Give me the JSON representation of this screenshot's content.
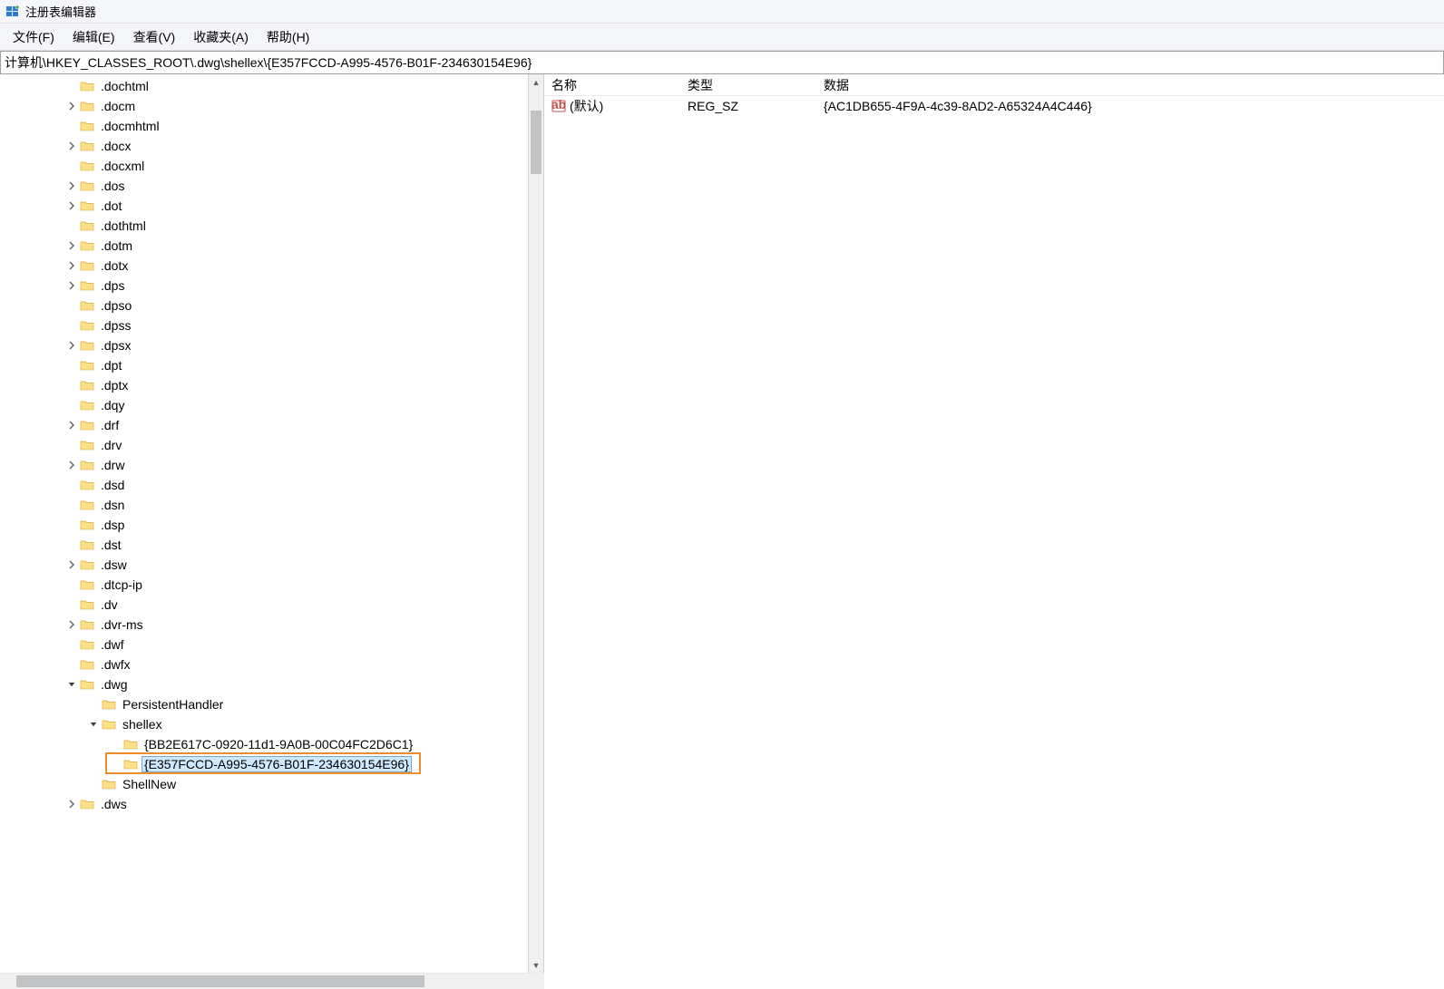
{
  "window": {
    "title": "注册表编辑器"
  },
  "menu": {
    "file": "文件(F)",
    "edit": "编辑(E)",
    "view": "查看(V)",
    "fav": "收藏夹(A)",
    "help": "帮助(H)"
  },
  "address": "计算机\\HKEY_CLASSES_ROOT\\.dwg\\shellex\\{E357FCCD-A995-4576-B01F-234630154E96}",
  "tree": [
    {
      "label": ".dochtml",
      "depth": 3,
      "expander": "none"
    },
    {
      "label": ".docm",
      "depth": 3,
      "expander": "closed"
    },
    {
      "label": ".docmhtml",
      "depth": 3,
      "expander": "none"
    },
    {
      "label": ".docx",
      "depth": 3,
      "expander": "closed"
    },
    {
      "label": ".docxml",
      "depth": 3,
      "expander": "none"
    },
    {
      "label": ".dos",
      "depth": 3,
      "expander": "closed"
    },
    {
      "label": ".dot",
      "depth": 3,
      "expander": "closed"
    },
    {
      "label": ".dothtml",
      "depth": 3,
      "expander": "none"
    },
    {
      "label": ".dotm",
      "depth": 3,
      "expander": "closed"
    },
    {
      "label": ".dotx",
      "depth": 3,
      "expander": "closed"
    },
    {
      "label": ".dps",
      "depth": 3,
      "expander": "closed"
    },
    {
      "label": ".dpso",
      "depth": 3,
      "expander": "none"
    },
    {
      "label": ".dpss",
      "depth": 3,
      "expander": "none"
    },
    {
      "label": ".dpsx",
      "depth": 3,
      "expander": "closed"
    },
    {
      "label": ".dpt",
      "depth": 3,
      "expander": "none"
    },
    {
      "label": ".dptx",
      "depth": 3,
      "expander": "none"
    },
    {
      "label": ".dqy",
      "depth": 3,
      "expander": "none"
    },
    {
      "label": ".drf",
      "depth": 3,
      "expander": "closed"
    },
    {
      "label": ".drv",
      "depth": 3,
      "expander": "none"
    },
    {
      "label": ".drw",
      "depth": 3,
      "expander": "closed"
    },
    {
      "label": ".dsd",
      "depth": 3,
      "expander": "none"
    },
    {
      "label": ".dsn",
      "depth": 3,
      "expander": "none"
    },
    {
      "label": ".dsp",
      "depth": 3,
      "expander": "none"
    },
    {
      "label": ".dst",
      "depth": 3,
      "expander": "none"
    },
    {
      "label": ".dsw",
      "depth": 3,
      "expander": "closed"
    },
    {
      "label": ".dtcp-ip",
      "depth": 3,
      "expander": "none"
    },
    {
      "label": ".dv",
      "depth": 3,
      "expander": "none"
    },
    {
      "label": ".dvr-ms",
      "depth": 3,
      "expander": "closed"
    },
    {
      "label": ".dwf",
      "depth": 3,
      "expander": "none"
    },
    {
      "label": ".dwfx",
      "depth": 3,
      "expander": "none"
    },
    {
      "label": ".dwg",
      "depth": 3,
      "expander": "open"
    },
    {
      "label": "PersistentHandler",
      "depth": 4,
      "expander": "none"
    },
    {
      "label": "shellex",
      "depth": 4,
      "expander": "open"
    },
    {
      "label": "{BB2E617C-0920-11d1-9A0B-00C04FC2D6C1}",
      "depth": 5,
      "expander": "none"
    },
    {
      "label": "{E357FCCD-A995-4576-B01F-234630154E96}",
      "depth": 5,
      "expander": "none",
      "selected": true,
      "highlighted": true
    },
    {
      "label": "ShellNew",
      "depth": 4,
      "expander": "none"
    },
    {
      "label": ".dws",
      "depth": 3,
      "expander": "closed"
    }
  ],
  "list": {
    "columns": {
      "name": "名称",
      "type": "类型",
      "data": "数据"
    },
    "col_widths": {
      "name": 150,
      "type": 150,
      "data": 600
    },
    "rows": [
      {
        "name": "(默认)",
        "type": "REG_SZ",
        "data": "{AC1DB655-4F9A-4c39-8AD2-A65324A4C446}"
      }
    ]
  }
}
